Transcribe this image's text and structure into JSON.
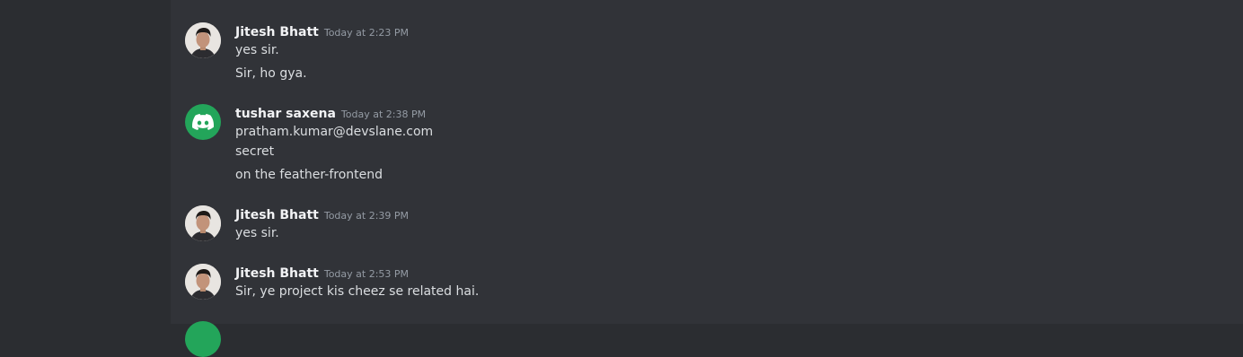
{
  "messages": [
    {
      "author": "Jitesh Bhatt",
      "timestamp": "Today at 2:23 PM",
      "avatar": "user-photo-avatar",
      "lines": [
        "yes sir.",
        "Sir, ho gya."
      ]
    },
    {
      "author": "tushar saxena",
      "timestamp": "Today at 2:38 PM",
      "avatar": "discord-logo-icon",
      "avatar_color": "#23a55a",
      "lines": [
        "pratham.kumar@devslane.com",
        "secret",
        "on the feather-frontend"
      ]
    },
    {
      "author": "Jitesh Bhatt",
      "timestamp": "Today at 2:39 PM",
      "avatar": "user-photo-avatar",
      "lines": [
        "yes sir."
      ]
    },
    {
      "author": "Jitesh Bhatt",
      "timestamp": "Today at 2:53 PM",
      "avatar": "user-photo-avatar",
      "lines": [
        "Sir, ye project kis cheez se related hai."
      ]
    }
  ],
  "colors": {
    "sidebar_bg": "#2b2d31",
    "chat_bg": "#313338",
    "username": "#f2f3f5",
    "timestamp": "#949ba4",
    "message_text": "#dbdee1",
    "discord_green": "#23a55a"
  }
}
